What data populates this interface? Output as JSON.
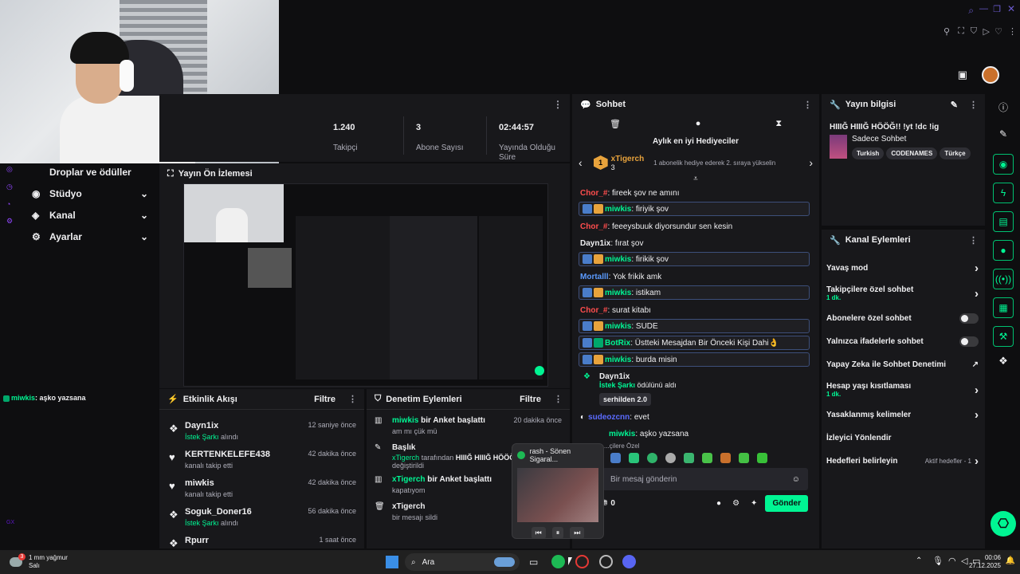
{
  "stats": [
    {
      "value": "1.240",
      "label": "Takipçi"
    },
    {
      "value": "3",
      "label": "Abone Sayısı"
    },
    {
      "value": "02:44:57",
      "label": "Yayında Olduğu Süre"
    }
  ],
  "leftnav": [
    {
      "label": "Droplar ve ödüller"
    },
    {
      "label": "Stüdyo"
    },
    {
      "label": "Kanal"
    },
    {
      "label": "Ayarlar"
    }
  ],
  "preview": {
    "title": "Yayın Ön İzlemesi"
  },
  "overlay_chat": {
    "user": "miwkis",
    "text": ": aşko yazsana"
  },
  "activity": {
    "title": "Etkinlik Akışı",
    "filter": "Filtre",
    "items": [
      {
        "name": "Dayn1ix",
        "sub": "İstek Şarkı",
        "sub2": "alındı",
        "time": "12 saniye önce",
        "icon": "gift-icon"
      },
      {
        "name": "KERTENKELEFE438",
        "sub": "kanalı takip etti",
        "time": "42 dakika önce",
        "icon": "heart-icon"
      },
      {
        "name": "miwkis",
        "sub": "kanalı takip etti",
        "time": "42 dakika önce",
        "icon": "heart-icon"
      },
      {
        "name": "Soguk_Doner16",
        "sub": "İstek Şarkı",
        "sub2": "alındı",
        "time": "56 dakika önce",
        "icon": "gift-icon"
      },
      {
        "name": "Rpurr",
        "sub": "",
        "time": "1 saat önce",
        "icon": "gift-icon"
      }
    ]
  },
  "moderation": {
    "title": "Denetim Eylemleri",
    "filter": "Filtre",
    "items": [
      {
        "name": "miwkis",
        "action": "bir Anket başlattı",
        "sub": "am mı çük mü",
        "time": "20 dakika önce"
      },
      {
        "name": "Başlık",
        "line2user": "xTigerch",
        "line2": "tarafından",
        "line2b": "HIIIĞ HIIIĞ HÖÖĞ!!",
        "sub": "değiştirildi"
      },
      {
        "name": "xTigerch",
        "action": "bir Anket başlattı",
        "sub": "kapatıyom"
      },
      {
        "name": "xTigerch",
        "action": "",
        "sub": "bir mesajı sildi"
      }
    ]
  },
  "chat": {
    "title": "Sohbet",
    "gifters_title": "Aylık en iyi Hediyeciler",
    "gifter": "xTigerch",
    "gifter_count": "3",
    "gifter_note": "1 abonelik hediye ederek 2. sıraya yükselin",
    "messages": [
      {
        "user": "Chor_#",
        "color": "#ff4d4d",
        "text": ": fireek şov ne amını",
        "hl": false
      },
      {
        "user": "miwkis",
        "color": "#00f593",
        "text": ": firiyik şov",
        "hl": true
      },
      {
        "user": "Chor_#",
        "color": "#ff4d4d",
        "text": ": feeeysbuuk diyorsundur sen kesin",
        "hl": false
      },
      {
        "user": "Dayn1ix",
        "color": "#efeff1",
        "text": ": fırat şov",
        "hl": false
      },
      {
        "user": "miwkis",
        "color": "#00f593",
        "text": ": firikik şov",
        "hl": true
      },
      {
        "user": "Mortalll",
        "color": "#5b9bff",
        "text": ": Yok frikik amk",
        "hl": false
      },
      {
        "user": "miwkis",
        "color": "#00f593",
        "text": ": istikam",
        "hl": true
      },
      {
        "user": "Chor_#",
        "color": "#ff4d4d",
        "text": ": surat kitabı",
        "hl": false
      },
      {
        "user": "miwkis",
        "color": "#00f593",
        "text": ": SUDE",
        "hl": true
      },
      {
        "user": "BotRix",
        "color": "#00f593",
        "text": ": Üstteki Mesajdan Bir Önceki Kişi Dahi👌",
        "hl": true
      },
      {
        "user": "miwkis",
        "color": "#00f593",
        "text": ": burda misin",
        "hl": true
      }
    ],
    "reward_user": "Dayn1ix",
    "reward_item": "İstek Şarkı",
    "reward_text": "ödülünü aldı",
    "reward_song": "serhilden 2.0",
    "sudeo_user": "sudeozcnn",
    "sudeo_text": ": evet",
    "last_user": "miwkis",
    "last_text": ": aşko yazsana",
    "emote_label": "...çilere Özel",
    "input_placeholder": "Bir mesaj gönderin",
    "send_label": "Gönder",
    "points": "0"
  },
  "info": {
    "title": "Yayın bilgisi",
    "stream_title": "HIIIĞ HIIIĞ HÖÖĞ!! !yt !dc !ig",
    "category": "Sadece Sohbet",
    "tags": [
      "Turkish",
      "CODENAMES",
      "Türkçe"
    ]
  },
  "chanact": {
    "title": "Kanal Eylemleri",
    "items": [
      {
        "label": "Yavaş mod",
        "kind": "arrow"
      },
      {
        "label": "Takipçilere özel sohbet",
        "sub": "1 dk.",
        "kind": "arrow"
      },
      {
        "label": "Abonelere özel sohbet",
        "kind": "toggle"
      },
      {
        "label": "Yalnızca ifadelerle sohbet",
        "kind": "toggle"
      },
      {
        "label": "Yapay Zeka ile Sohbet Denetimi",
        "kind": "ext"
      },
      {
        "label": "Hesap yaşı kısıtlaması",
        "sub": "1 dk.",
        "kind": "arrow"
      },
      {
        "label": "Yasaklanmış kelimeler",
        "kind": "arrow"
      },
      {
        "label": "İzleyici Yönlendir",
        "kind": "none"
      },
      {
        "label": "Hedefleri belirleyin",
        "extra": "Aktif hedefler - 1",
        "kind": "arrow"
      }
    ]
  },
  "spotify": {
    "title": "rash - Sönen Sigaral..."
  },
  "taskbar": {
    "weather_temp": "3",
    "weather_text": "1 mm yağmur",
    "weather_day": "Salı",
    "search": "Ara",
    "time": "00:06",
    "date": "27.12.2025"
  },
  "sidebar_small": {
    "gx": "GX"
  },
  "colors": {
    "accent": "#00f593",
    "bg": "#0e0e10",
    "panel": "#18181b"
  }
}
